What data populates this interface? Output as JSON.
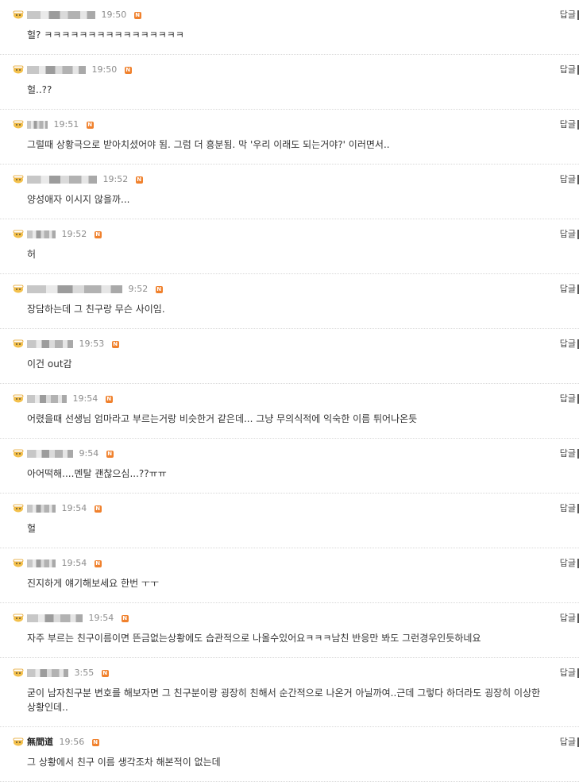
{
  "reply_label": "답글",
  "badge_letter": "N",
  "comments": [
    {
      "nick": "",
      "nick_w": 86,
      "time": "19:50",
      "text": "헐? ㅋㅋㅋㅋㅋㅋㅋㅋㅋㅋㅋㅋㅋㅋㅋㅋ"
    },
    {
      "nick": "",
      "nick_w": 74,
      "time": "19:50",
      "text": "헐..??"
    },
    {
      "nick": "",
      "nick_w": 26,
      "time": "19:51",
      "text": "그럴때 상황극으로 받아치셨어야 됨. 그럼 더 흥분됨. 막 '우리 이래도 되는거야?' 이러면서.."
    },
    {
      "nick": "",
      "nick_w": 88,
      "time": "19:52",
      "text": "양성애자 이시지 않을까..."
    },
    {
      "nick": "",
      "nick_w": 36,
      "time": "19:52",
      "text": "허"
    },
    {
      "nick": "",
      "nick_w": 120,
      "time": "9:52",
      "text": "장담하는데 그 친구랑 무슨 사이임."
    },
    {
      "nick": "",
      "nick_w": 58,
      "time": "19:53",
      "text": "이건 out감"
    },
    {
      "nick": "",
      "nick_w": 50,
      "time": "19:54",
      "text": "어렸을때 선생님 엄마라고 부르는거랑 비슷한거 같은데... 그냥 무의식적에 익숙한 이름 튀어나온듯"
    },
    {
      "nick": "",
      "nick_w": 58,
      "time": "9:54",
      "text": "아어떡해....멘탈 괜찮으심...??ㅠㅠ"
    },
    {
      "nick": "",
      "nick_w": 36,
      "time": "19:54",
      "text": "헐"
    },
    {
      "nick": "",
      "nick_w": 36,
      "time": "19:54",
      "text": "진지하게 얘기해보세요 한번 ㅜㅜ"
    },
    {
      "nick": "",
      "nick_w": 70,
      "time": "19:54",
      "text": "자주 부르는 친구이름이면 뜬금없는상황에도 습관적으로 나올수있어요ㅋㅋㅋ남친 반응만 봐도 그런경우인듯하네요"
    },
    {
      "nick": "",
      "nick_w": 52,
      "time": "3:55",
      "text": "굳이 남자친구분 변호를 해보자면 그 친구분이랑 굉장히 친해서 순간적으로 나온거 아닐까여..근데 그렇다 하더라도 굉장히 이상한 상황인데.."
    },
    {
      "nick": "無間道",
      "nick_w": 0,
      "time": "19:56",
      "text": "그 상황에서 친구 이름 생각조차 해본적이 없는데"
    }
  ]
}
